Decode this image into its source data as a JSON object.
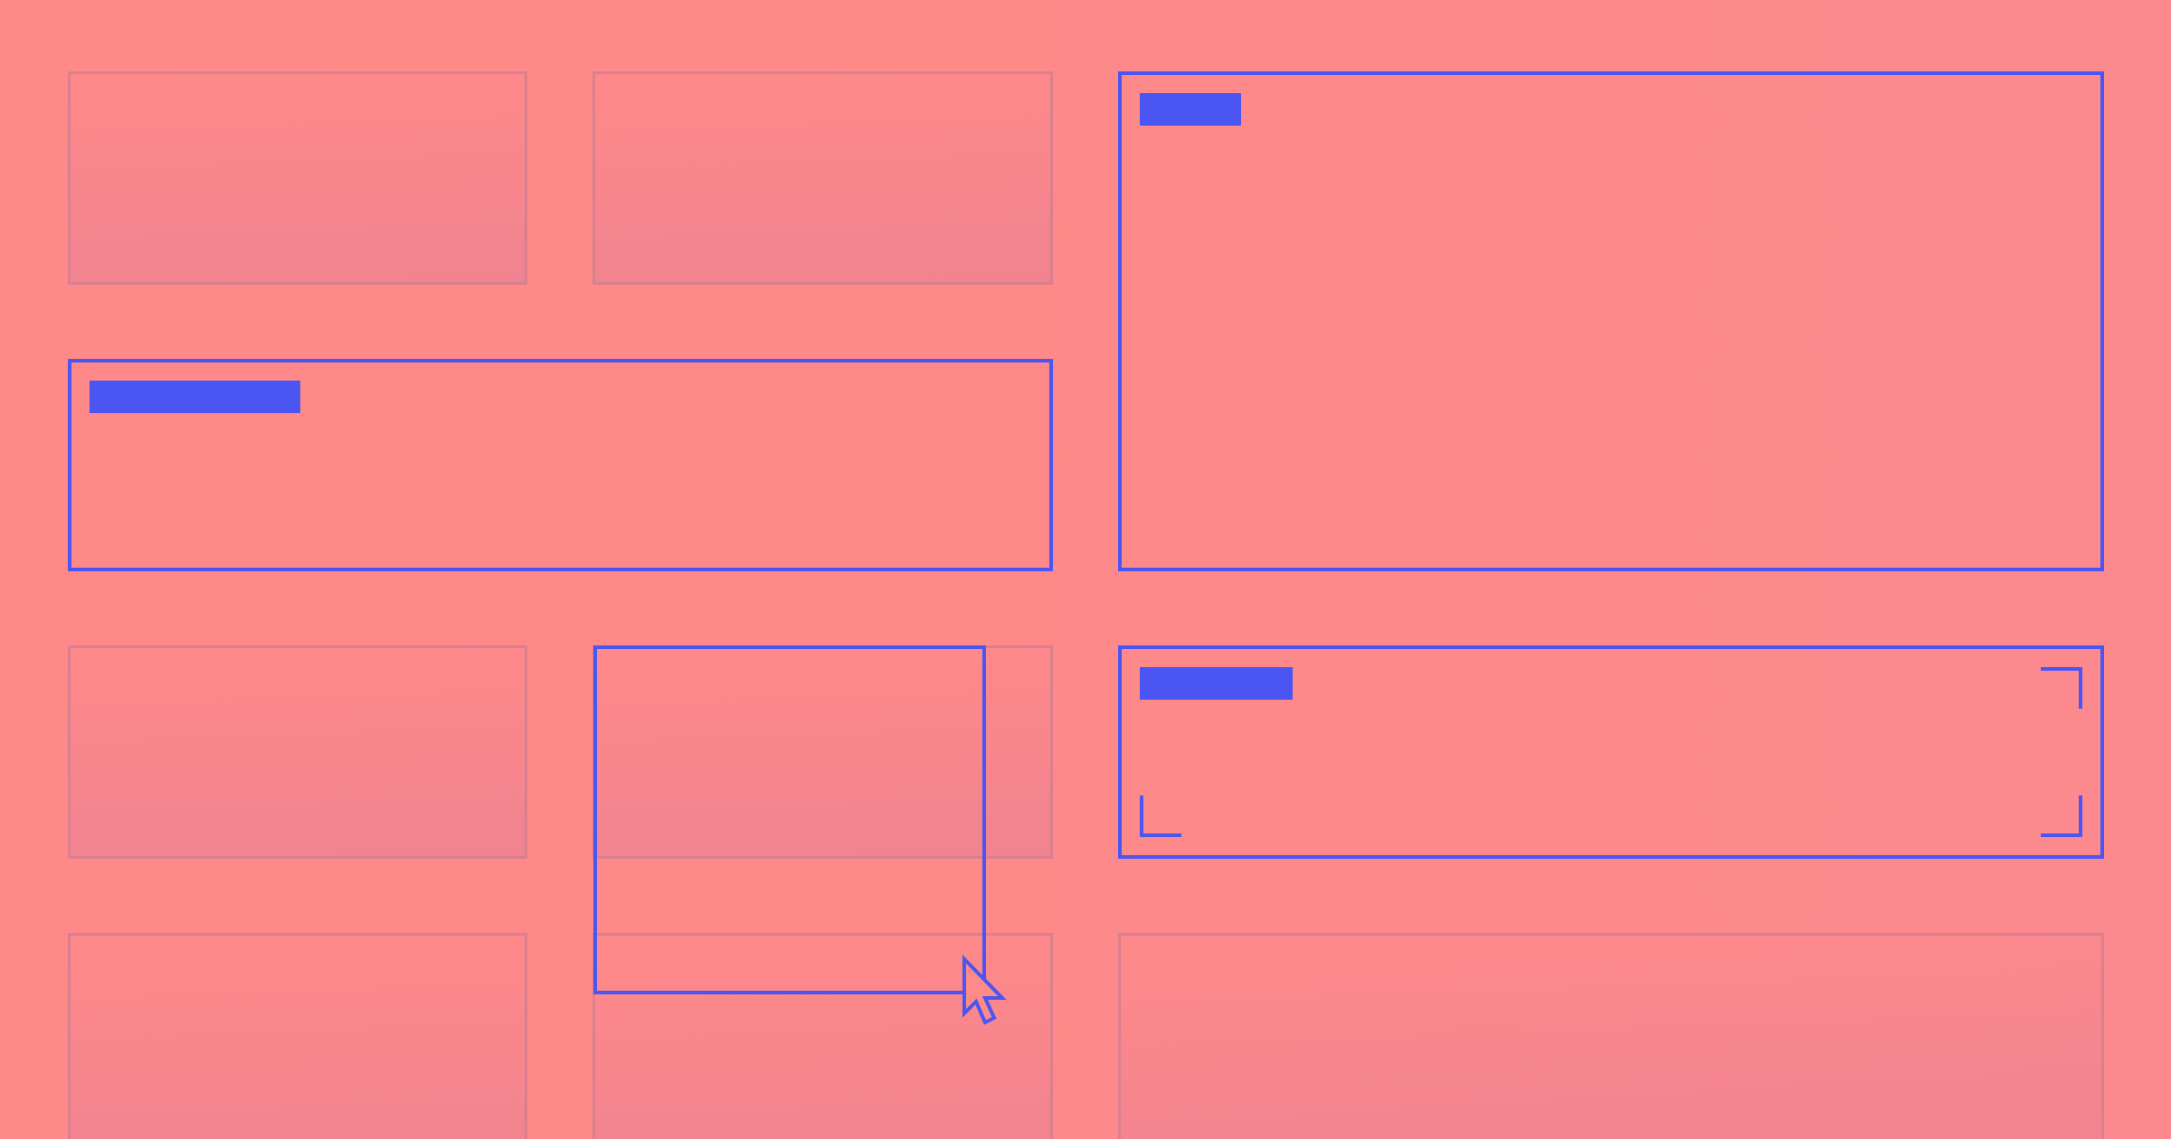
{
  "colors": {
    "background": "#ff8989",
    "accent": "#4a55f2",
    "ghost_border": "#d9808f",
    "ghost_fill_bottom": "#ec8193"
  },
  "tiles": [
    {
      "id": "tile-1",
      "state": "inactive"
    },
    {
      "id": "tile-2",
      "state": "inactive"
    },
    {
      "id": "tile-3",
      "state": "active",
      "has_label_bar": true
    },
    {
      "id": "tile-4",
      "state": "active",
      "has_label_bar": true
    },
    {
      "id": "tile-5",
      "state": "inactive"
    },
    {
      "id": "tile-6",
      "state": "inactive"
    },
    {
      "id": "tile-7",
      "state": "active",
      "has_label_bar": true,
      "has_corner_marks": true
    },
    {
      "id": "tile-8",
      "state": "inactive"
    },
    {
      "id": "tile-9",
      "state": "inactive"
    },
    {
      "id": "tile-10",
      "state": "inactive"
    }
  ],
  "selection": {
    "active": true
  },
  "cursor": {
    "icon": "arrow-pointer-icon"
  }
}
